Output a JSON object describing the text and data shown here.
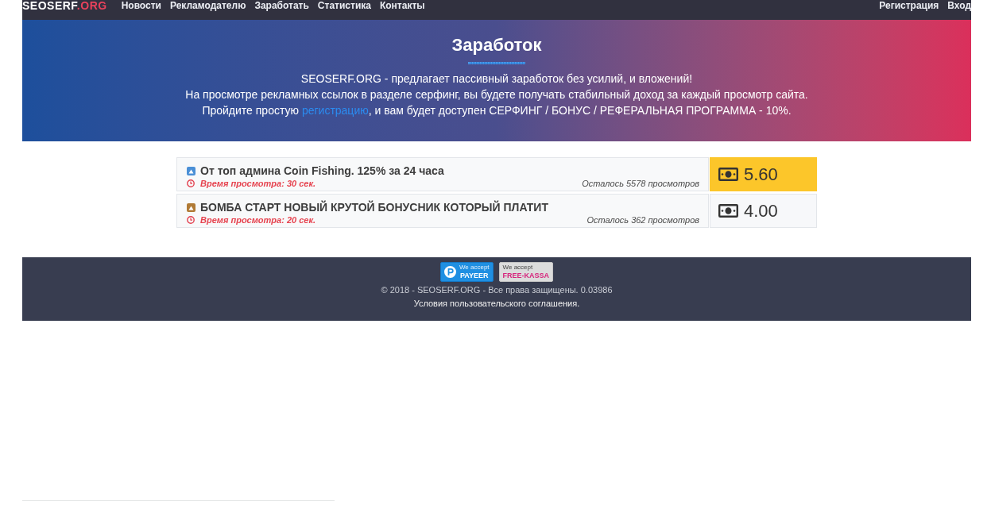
{
  "nav": {
    "logo": {
      "main": "SEOSERF",
      "accent": ".ORG"
    },
    "links": [
      "Новости",
      "Рекламодателю",
      "Заработать",
      "Статистика",
      "Контакты"
    ],
    "account_links": [
      "Регистрация",
      "Вход"
    ]
  },
  "hero": {
    "title": "Заработок",
    "lines": [
      "SEOSERF.ORG - предлагает пассивный заработок без усилий, и вложений!",
      "На просмотре рекламных ссылок в разделе серфинг, вы будете получать стабильный доход за каждый просмотр сайта."
    ],
    "signup": {
      "before": "Пройдите простую ",
      "link": "регистрацию",
      "after": ", и вам будет доступен СЕРФИНГ / БОНУС / РЕФЕРАЛЬНАЯ ПРОГРАММА - 10%."
    }
  },
  "offers": [
    {
      "title": "От топ админа Coin Fishing. 125% за 24 часа",
      "color": "#4a8fd6",
      "view_time": "Время просмотра: 30 сек.",
      "remaining": "Осталось 5578 просмотров",
      "price": "5.60",
      "highlighted": true
    },
    {
      "title": "БОМБА СТАРТ НОВЫЙ КРУТОЙ БОНУСНИК КОТОРЫЙ ПЛАТИТ",
      "color": "#b07a35",
      "view_time": "Время просмотра: 20 сек.",
      "remaining": "Осталось 362 просмотров",
      "price": "4.00",
      "highlighted": false
    }
  ],
  "footer": {
    "badges": [
      {
        "kind": "payeer",
        "caption": "We accept",
        "label": "PAYEER"
      },
      {
        "kind": "free-kassa",
        "caption": "We accept",
        "label": "FREE-KASSA"
      }
    ],
    "copyright": "© 2018 - SEOSERF.ORG - Все права защищены. 0.03986",
    "terms": "Условия пользовательского соглашения."
  }
}
